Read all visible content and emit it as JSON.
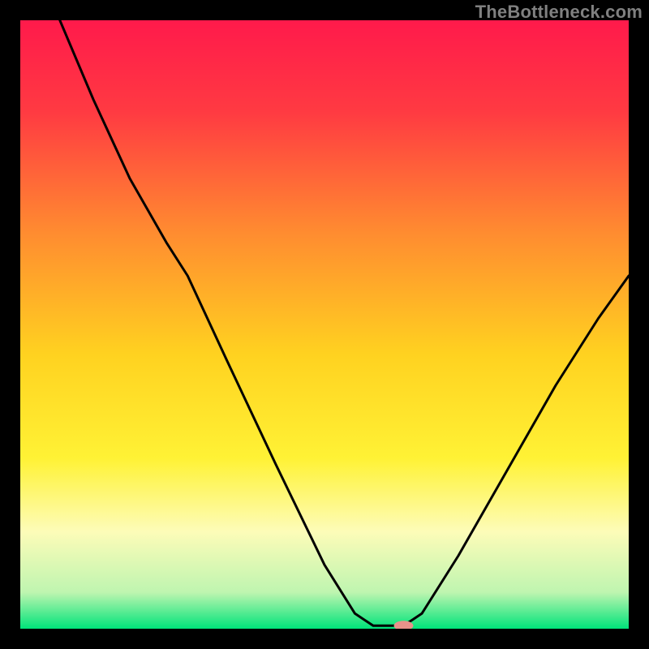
{
  "watermark": "TheBottleneck.com",
  "chart_data": {
    "type": "line",
    "title": "",
    "xlabel": "",
    "ylabel": "",
    "xlim": [
      0,
      100
    ],
    "ylim": [
      0,
      100
    ],
    "grid": false,
    "legend": false,
    "background_gradient_stops": [
      {
        "offset": 0.0,
        "color": "#ff1a4b"
      },
      {
        "offset": 0.15,
        "color": "#ff3a42"
      },
      {
        "offset": 0.35,
        "color": "#ff8c30"
      },
      {
        "offset": 0.55,
        "color": "#ffd220"
      },
      {
        "offset": 0.72,
        "color": "#fff235"
      },
      {
        "offset": 0.84,
        "color": "#fdfcb8"
      },
      {
        "offset": 0.94,
        "color": "#bff5b0"
      },
      {
        "offset": 1.0,
        "color": "#00e37a"
      }
    ],
    "curve_points": [
      {
        "x": 6.5,
        "y": 100.0
      },
      {
        "x": 12.0,
        "y": 87.0
      },
      {
        "x": 18.0,
        "y": 74.0
      },
      {
        "x": 24.0,
        "y": 63.5
      },
      {
        "x": 27.5,
        "y": 58.0
      },
      {
        "x": 34.0,
        "y": 44.0
      },
      {
        "x": 42.0,
        "y": 27.0
      },
      {
        "x": 50.0,
        "y": 10.5
      },
      {
        "x": 55.0,
        "y": 2.5
      },
      {
        "x": 58.0,
        "y": 0.5
      },
      {
        "x": 63.0,
        "y": 0.5
      },
      {
        "x": 66.0,
        "y": 2.5
      },
      {
        "x": 72.0,
        "y": 12.0
      },
      {
        "x": 80.0,
        "y": 26.0
      },
      {
        "x": 88.0,
        "y": 40.0
      },
      {
        "x": 95.0,
        "y": 51.0
      },
      {
        "x": 100.0,
        "y": 58.0
      }
    ],
    "marker": {
      "x": 63.0,
      "y": 0.5,
      "color": "#e8928a",
      "rx": 12,
      "ry": 6
    }
  }
}
